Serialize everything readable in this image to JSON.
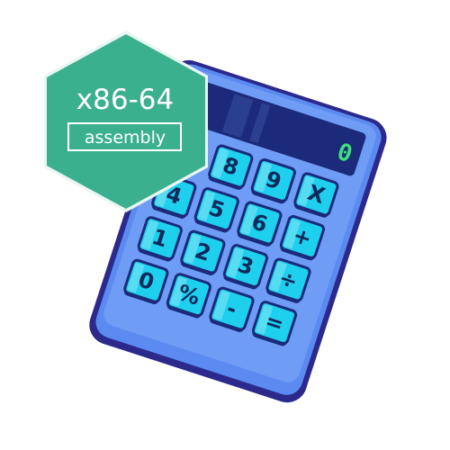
{
  "badge": {
    "title": "x86-64",
    "subtitle": "assembly"
  },
  "calculator": {
    "display": "0",
    "keys": [
      [
        "8",
        "9",
        "X"
      ],
      [
        "4",
        "5",
        "6",
        "+"
      ],
      [
        "1",
        "2",
        "3",
        "÷"
      ],
      [
        "0",
        "%",
        "-",
        "="
      ]
    ]
  },
  "colors": {
    "badge_fill": "#3bb08f",
    "calculator_outline": "#2b2a8c",
    "calculator_body": "#5b8bf0",
    "key_face": "#1fd0ee",
    "display_screen": "#1b2a7a",
    "display_digit": "#3fe07a"
  }
}
